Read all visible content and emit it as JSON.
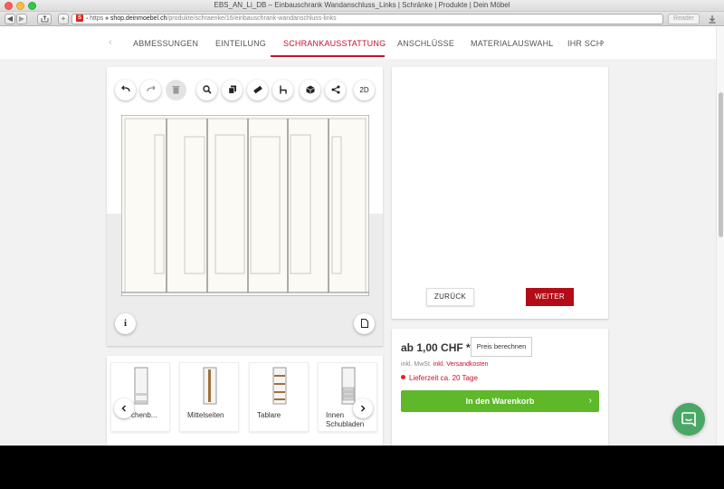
{
  "window": {
    "title": "EBS_AN_Li_DB – Einbauschrank Wandanschluss_Links | Schränke | Produkte | Dein Möbel"
  },
  "browser": {
    "url_scheme": "https",
    "url_host": "shop.deinmoebel.ch",
    "url_path": "/produkte/schraenke/16/einbauschrank-wandanschluss-links",
    "reader_label": "Reader",
    "favicon_letter": "S"
  },
  "steps": [
    {
      "label": "ABMESSUNGEN"
    },
    {
      "label": "EINTEILUNG"
    },
    {
      "label": "SCHRANKAUSSTATTUNG"
    },
    {
      "label": "ANSCHLÜSSE"
    },
    {
      "label": "MATERIALAUSWAHL"
    },
    {
      "label": "IHR SCH"
    }
  ],
  "viewer": {
    "toolbar_icons": [
      "undo-icon",
      "redo-icon",
      "trash-icon",
      "zoom-icon",
      "copy-icon",
      "ruler-icon",
      "chair-icon",
      "cube-icon",
      "share-icon"
    ],
    "mode_label": "2D",
    "info_label": "i"
  },
  "nav_buttons": {
    "back": "ZURÜCK",
    "next": "WEITER"
  },
  "price": {
    "amount": "ab 1,00 CHF *",
    "calc_label": "Preis berechnen",
    "tax_text": "inkl. MwSt.",
    "shipping_text": "inkl. Versandkosten",
    "delivery": "Lieferzeit ca. 20 Tage",
    "cart_label": "In den Warenkorb",
    "cart_chevron": "›"
  },
  "items": [
    {
      "label": "chenb..."
    },
    {
      "label": "Mittelseiten"
    },
    {
      "label": "Tablare"
    },
    {
      "label": "Innen",
      "label2": "Schubladen"
    }
  ],
  "colors": {
    "brand_red": "#c8102e",
    "weiter_red": "#b30c16",
    "cart_green": "#5eb82a",
    "chat_green": "#4ba766"
  }
}
